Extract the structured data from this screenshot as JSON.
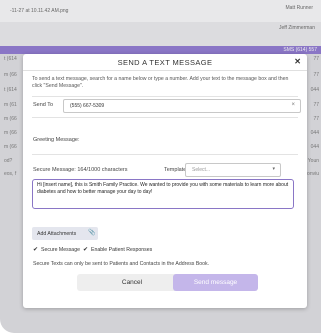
{
  "background": {
    "filename": "-11-27 at 10.11.42 AM.png",
    "user_name": "Matt Runner",
    "sub_name": "Jeff Zimmerman",
    "highlight_text": "SMS (614) 557",
    "left_rows": [
      "t (614",
      "m (66",
      "t (614",
      "m (61",
      "m (66",
      "m (66",
      "m (66",
      "od?",
      "eos, f"
    ],
    "right_rows": [
      "77",
      "77",
      "044",
      "77",
      "77",
      "044",
      "044",
      "Youn",
      "onviu"
    ],
    "colors": {
      "accent": "#8a76c6",
      "send_button": "#c4b6ea",
      "backdrop": "#d2d2d6"
    }
  },
  "modal": {
    "title": "SEND A TEXT MESSAGE",
    "close_label": "✕",
    "instructions": "To send a text message, search for a name below or type a number. Add your text to the message box and then click \"Send Message\".",
    "send_to_label": "Send To",
    "send_to_value": "(555) 667-5309",
    "send_to_clear": "×",
    "greeting_label": "Greeting Message:",
    "secure_message_label": "Secure Message: 164/1000 characters",
    "templates_label": "Templates:",
    "templates_placeholder": "Select...",
    "templates_arrow": "▾",
    "message_text": "Hi [insert name], this is Smith Family Practice. We wanted to provide you with some materials to learn more about diabetes and how to better manage your day to day!",
    "add_attachments_label": "Add Attachments",
    "secure_message_checkbox": "Secure Message",
    "enable_responses_checkbox": "Enable Patient Responses",
    "notice": "Secure Texts can only be sent to Patients and Contacts in the Address Book.",
    "cancel_label": "Cancel",
    "send_label": "Send message"
  }
}
